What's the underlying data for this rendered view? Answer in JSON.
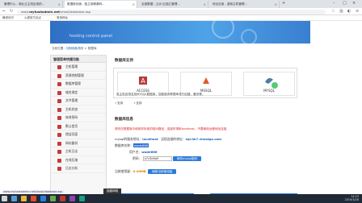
{
  "browser": {
    "tabs": [
      {
        "label": "管理中心 - 商业云主机应用的..."
      },
      {
        "label": "数据库页面 - 独立到期源码..."
      },
      {
        "label": "全部数据 - 云计/云独立管理..."
      },
      {
        "label": "综合应用 - 虚拟主机管理..."
      }
    ],
    "url_prefix": "www.",
    "url_domain": "myhostadmin.net",
    "url_path": "/vhost/database.asp",
    "bookmarks": [
      "最常访问",
      "火狐官方站点",
      "常用网址"
    ]
  },
  "hero": {
    "text": "hosting control panel"
  },
  "breadcrumb": {
    "prefix": "当前位置：",
    "link": "控制面板首页",
    "sep": " > ",
    "current": "数据库"
  },
  "sidebar": {
    "title": "管理菜单快捷功能",
    "items": [
      {
        "label": "主机管理"
      },
      {
        "label": "资源控制管理"
      },
      {
        "label": "数据库管理"
      },
      {
        "label": "域名绑定"
      },
      {
        "label": "文件管理"
      },
      {
        "label": "主机状态"
      },
      {
        "label": "修改密码"
      },
      {
        "label": "默认首页"
      },
      {
        "label": "错误页面"
      },
      {
        "label": "网站备份"
      },
      {
        "label": "主机日志"
      },
      {
        "label": "在线压缩"
      },
      {
        "label": "日志分析"
      }
    ]
  },
  "support": {
    "title": "数据库支持",
    "types": [
      {
        "label": "ACCESS"
      },
      {
        "label": "MSSQL"
      },
      {
        "label": "MYSQL"
      }
    ],
    "note": "该主机自带支持MYSQL数据库，您能够对数据库进行创建，备份等。",
    "options": [
      "支持",
      "支持"
    ]
  },
  "dbinfo": {
    "title": "数据库信息",
    "warning": "请勿在数据库中使用非标准的相对路径，连接时请用localhost，不要使用远程地址连接",
    "server_label": "mysql的服务地址：",
    "server_value": "localhost",
    "remote_label": "远程连接的地址：",
    "remote_value": "sql.hk7.vhostgo.com",
    "dbname_label": "数据库名称：",
    "dbname_value": "wode666",
    "user_label": "用户名：",
    "user_value": "wode666",
    "pass_label": "密码：",
    "pass_value": "a7z3e6q9",
    "pass_button": "修改mysql密码",
    "size_label": "当前使用量：",
    "size_value": "0.00MB",
    "size_button": "刷新当前使用量"
  },
  "footer": {
    "status_url": "www.myhostadmin.net/vhost/database.asp",
    "pill": "独客网络"
  },
  "taskbar": {
    "time": "14:25",
    "date": "2019/3/28"
  },
  "colors": {
    "accent": "#2e7bd6",
    "warning": "#dd2222",
    "sidebar_icon": "#c63b3b"
  }
}
